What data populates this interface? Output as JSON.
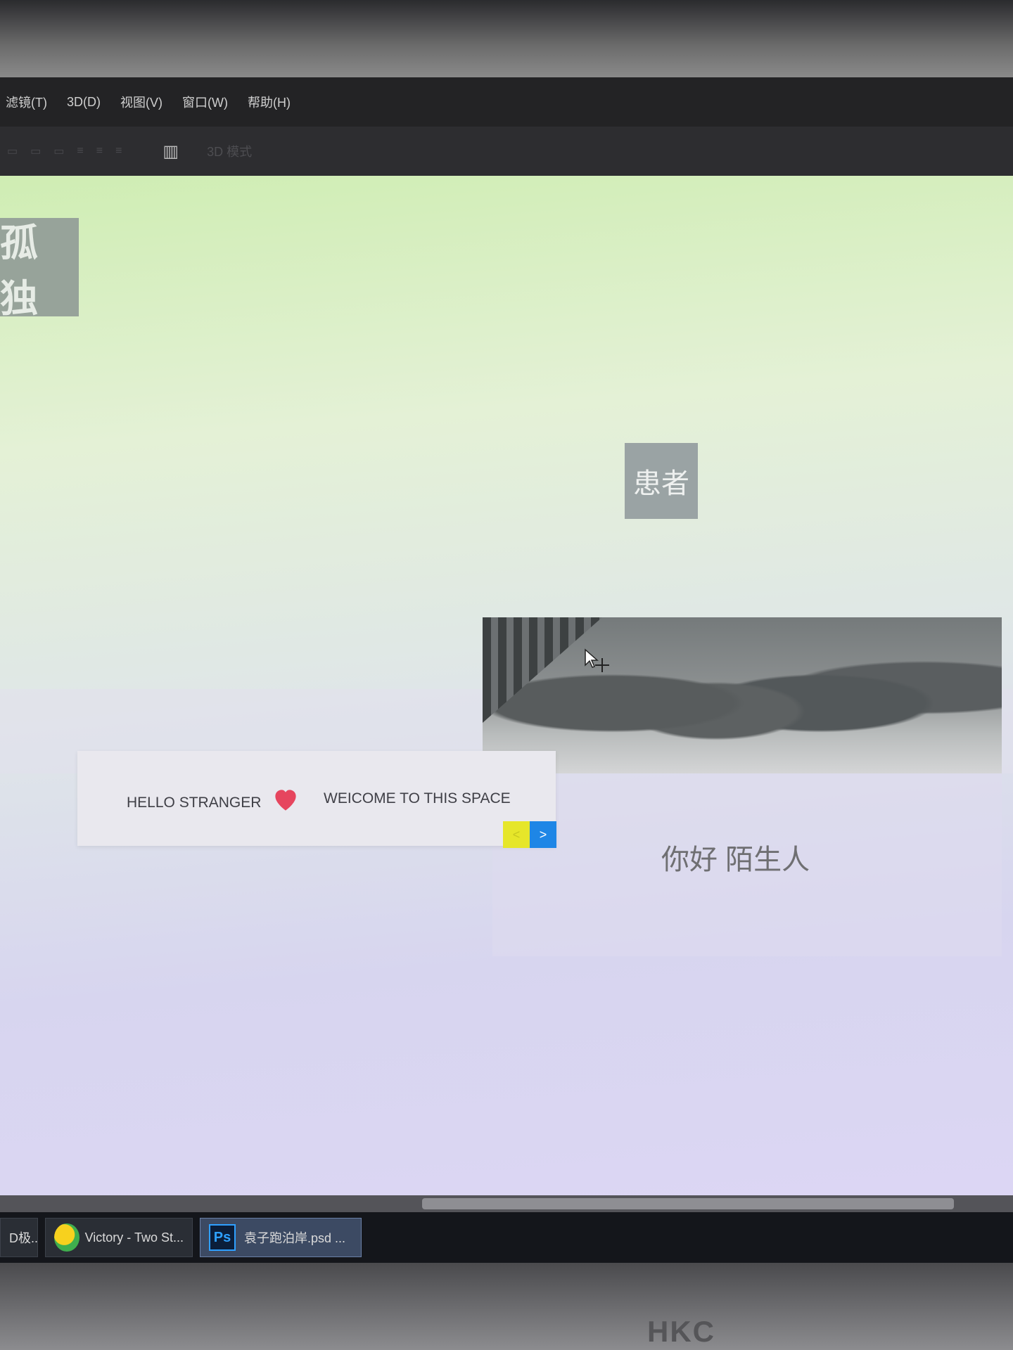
{
  "menu": {
    "items": [
      "滤镜(T)",
      "3D(D)",
      "视图(V)",
      "窗口(W)",
      "帮助(H)"
    ]
  },
  "options_bar": {
    "icons": [
      "align-icon",
      "align-icon",
      "align-icon",
      "distribute-icon",
      "distribute-icon",
      "distribute-icon"
    ],
    "mode_label": "3D 模式"
  },
  "canvas": {
    "left_tile_text": "孤独",
    "center_tile_text": "患者",
    "greeting": "你好  陌生人",
    "welcome_card": {
      "hello": "HELLO STRANGER",
      "welcome": "WEICOME TO THIS SPACE",
      "next_label": ">",
      "prev_label": "<"
    },
    "colors": {
      "heart": "#e6455e",
      "prev_button": "#e6e62a",
      "next_button": "#1e86e6"
    }
  },
  "taskbar": {
    "tasks": [
      {
        "label": "D极..."
      },
      {
        "label": "Victory - Two St..."
      },
      {
        "label": "袁子跑泊岸.psd ..."
      }
    ]
  },
  "monitor": {
    "brand": "HKC"
  }
}
